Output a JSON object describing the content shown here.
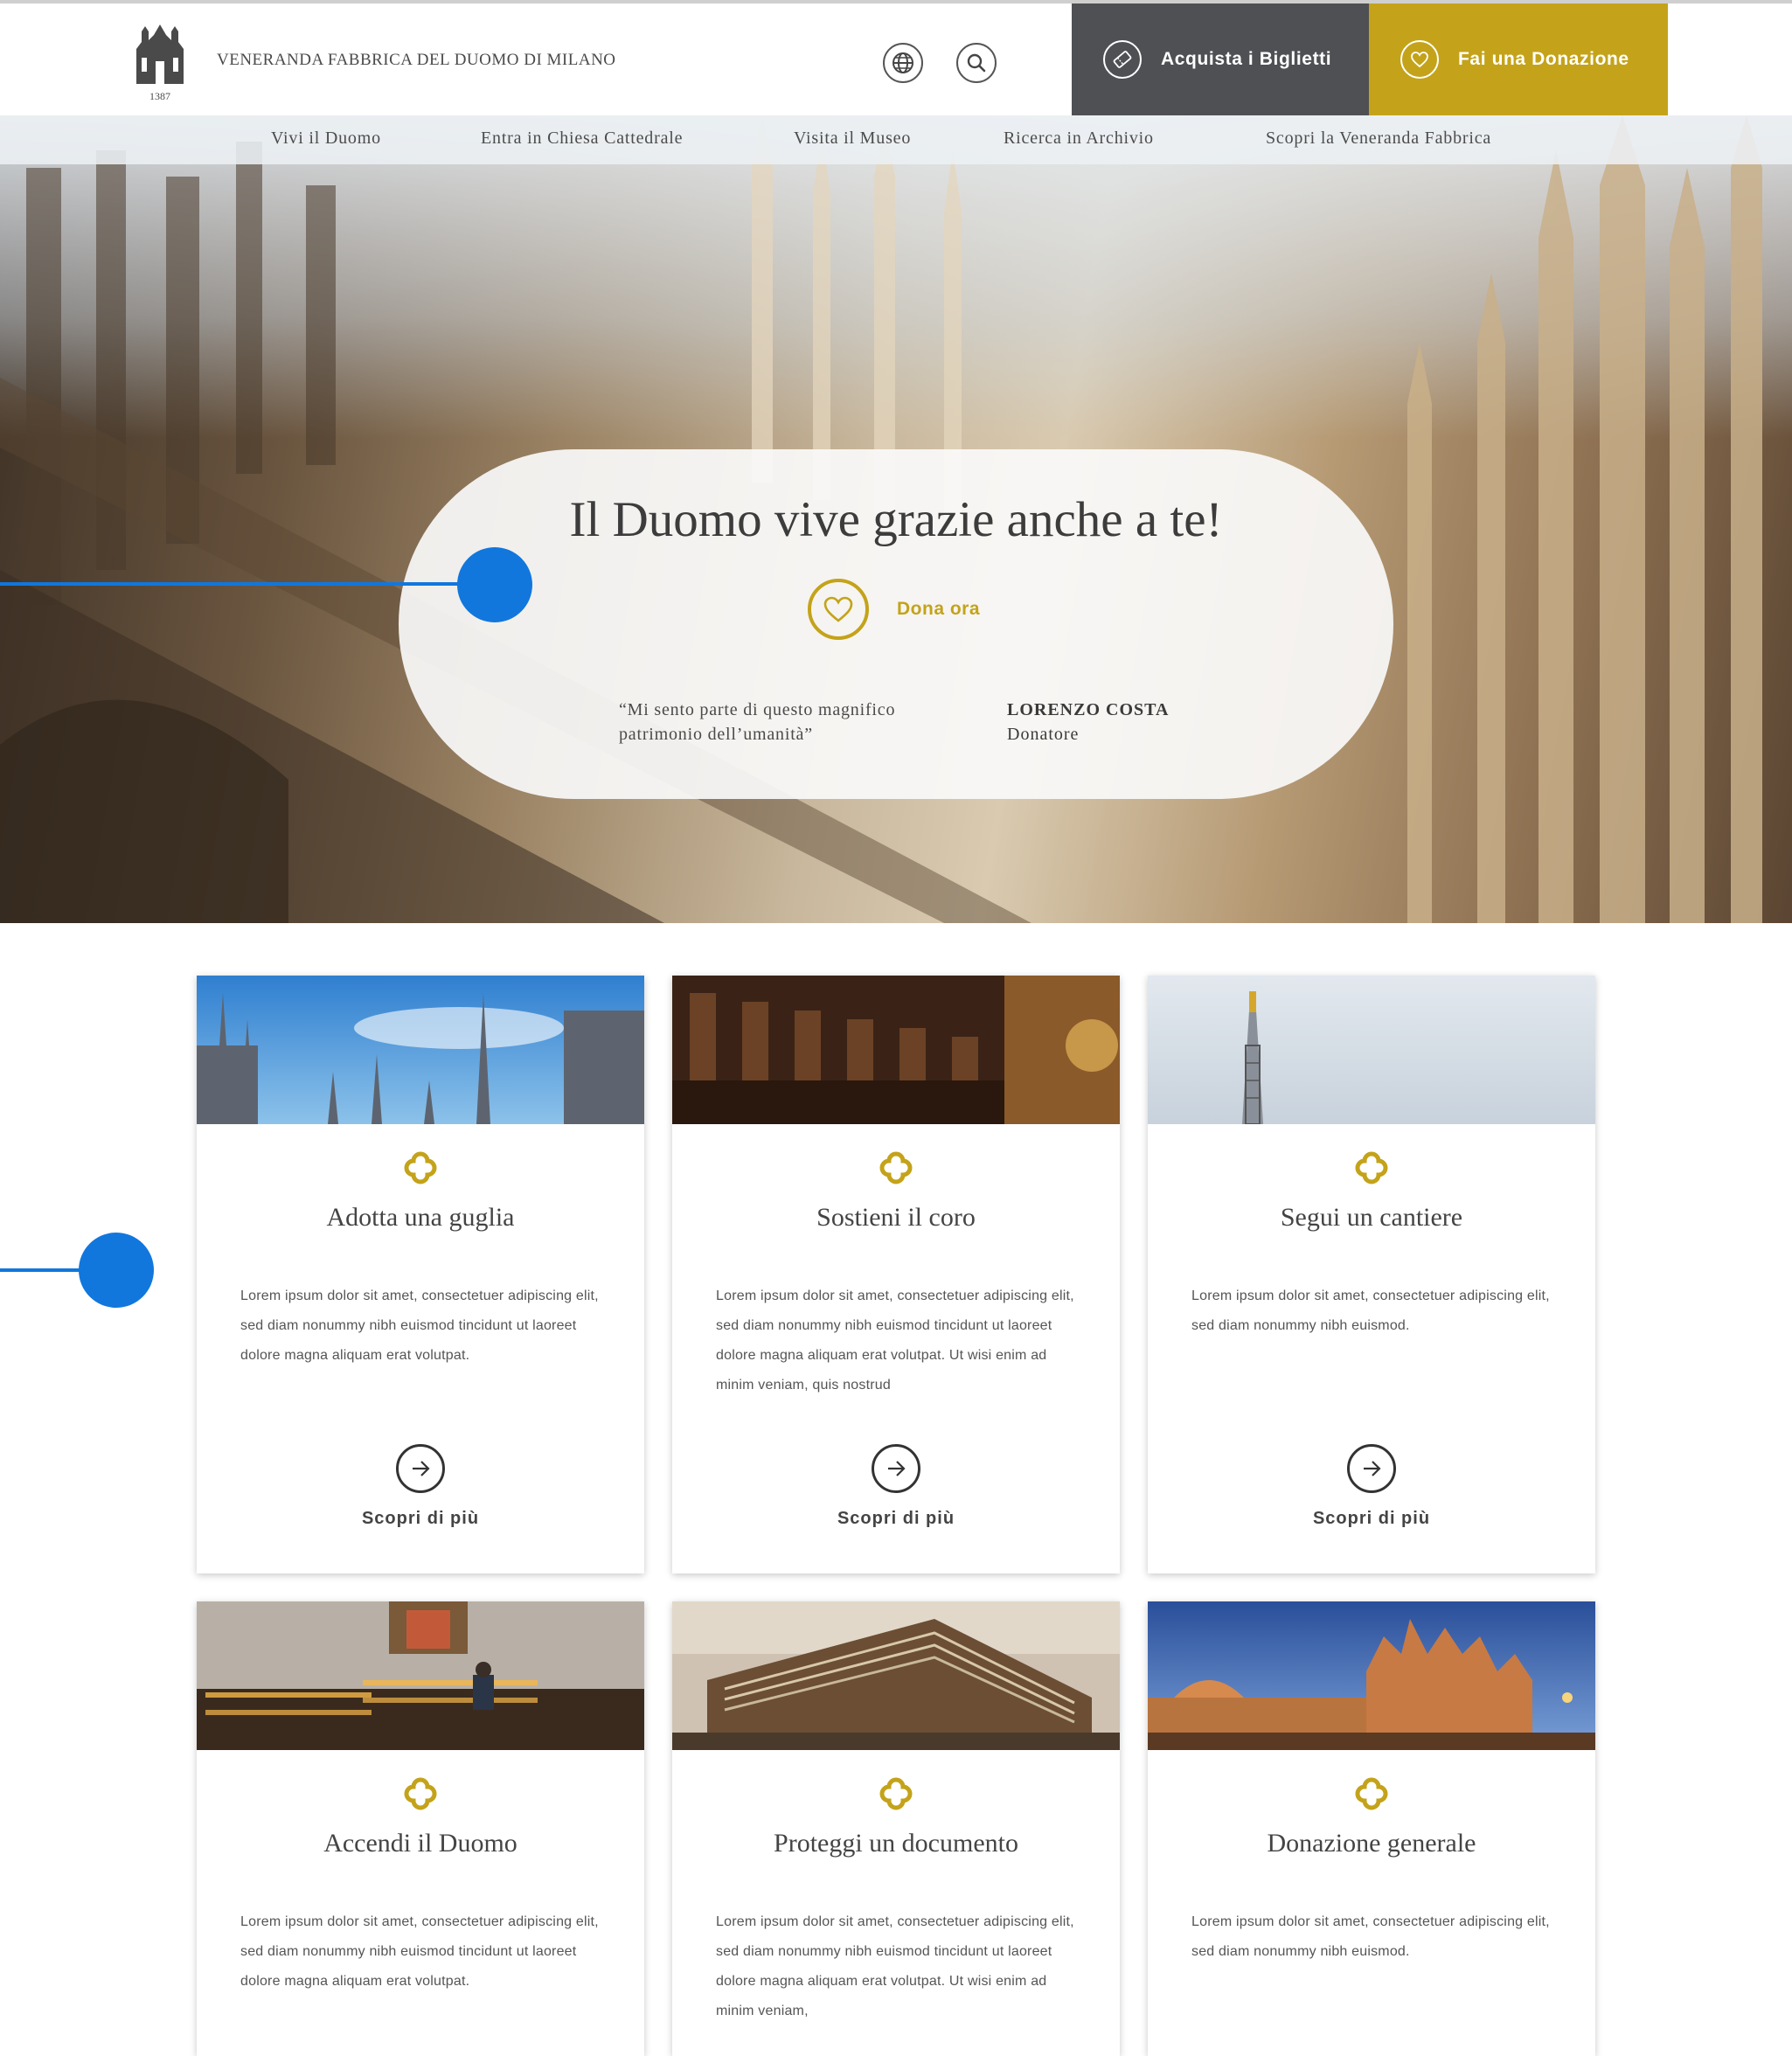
{
  "header": {
    "brand": "VENERANDA FABBRICA DEL DUOMO DI MILANO",
    "logo_year": "1387",
    "tickets_label": "Acquista i Biglietti",
    "donate_label": "Fai una Donazione",
    "colors": {
      "tickets_bg": "#4e5054",
      "donate_bg": "#c4a31a"
    }
  },
  "nav": {
    "items": [
      "Vivi il Duomo",
      "Entra in Chiesa Cattedrale",
      "Visita il Museo",
      "Ricerca in Archivio",
      "Scopri la Veneranda Fabbrica"
    ]
  },
  "hero": {
    "title": "Il Duomo vive grazie anche a te!",
    "cta": "Dona ora",
    "quote_line1": "“Mi sento parte di questo magnifico",
    "quote_line2": "patrimonio dell’umanità”",
    "author_name": "LORENZO COSTA",
    "author_role": "Donatore"
  },
  "cards": [
    {
      "title": "Adotta una guglia",
      "text": "Lorem ipsum dolor sit amet, consectetuer adipiscing elit, sed diam nonummy nibh euismod tincidunt ut laoreet dolore magna aliquam erat volutpat.",
      "link": "Scopri di più"
    },
    {
      "title": "Sostieni il coro",
      "text": "Lorem ipsum dolor sit amet, consectetuer adipiscing elit, sed diam nonummy nibh euismod tincidunt ut laoreet dolore magna aliquam erat volutpat. Ut wisi enim ad minim veniam, quis nostrud",
      "link": "Scopri di più"
    },
    {
      "title": "Segui un cantiere",
      "text": "Lorem ipsum dolor sit amet, consectetuer adipiscing elit, sed diam nonummy nibh euismod.",
      "link": "Scopri di più"
    },
    {
      "title": "Accendi il Duomo",
      "text": "Lorem ipsum dolor sit amet, consectetuer adipiscing elit, sed diam nonummy nibh euismod tincidunt ut laoreet dolore magna aliquam erat volutpat.",
      "link": ""
    },
    {
      "title": "Proteggi un documento",
      "text": "Lorem ipsum dolor sit amet, consectetuer adipiscing elit, sed diam nonummy nibh euismod tincidunt ut laoreet dolore magna aliquam erat volutpat. Ut wisi enim ad minim veniam,",
      "link": ""
    },
    {
      "title": "Donazione generale",
      "text": "Lorem ipsum dolor sit amet, consectetuer adipiscing elit, sed diam nonummy nibh euismod.",
      "link": ""
    }
  ],
  "icons": {
    "language": "globe-icon",
    "search": "search-icon",
    "tickets": "ticket-icon",
    "donate": "heart-icon",
    "card_symbol": "quatrefoil-icon",
    "card_link": "arrow-right-icon"
  },
  "accent_color": "#c4a31a",
  "annotation_color": "#1177dd"
}
